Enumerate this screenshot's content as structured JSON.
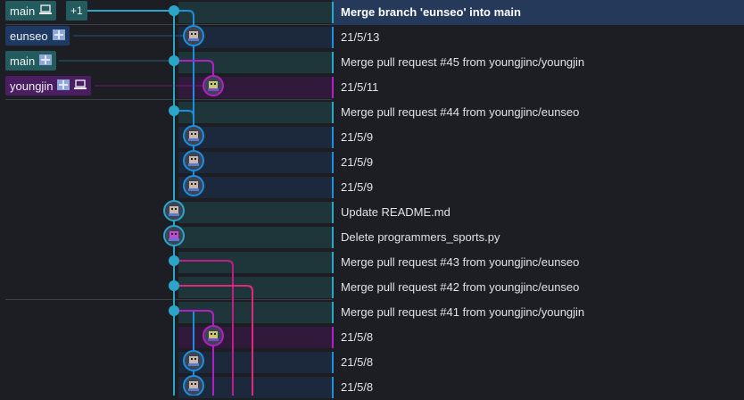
{
  "colors": {
    "background": "#1c1e23",
    "lane_cyan": "#2aa6c9",
    "lane_blue": "#1d8fe0",
    "lane_purple": "#b51ec4",
    "lane_magenta": "#c01e86",
    "lane_pink": "#e0287f",
    "row_teal": "#1f3b3d",
    "row_blue": "#1c2c42",
    "row_purple": "#33183d",
    "selected_row": "#253a5a"
  },
  "branch_labels": [
    {
      "name": "main",
      "icon": "laptop-icon",
      "extra": "+1",
      "row": 0,
      "style": "teal"
    },
    {
      "name": "eunseo",
      "icon": "remote-icon",
      "row": 1,
      "style": "blue"
    },
    {
      "name": "main",
      "icon": "remote-icon",
      "row": 2,
      "style": "teal"
    },
    {
      "name": "youngjin",
      "icon": "remote-icon",
      "icon2": "laptop-icon",
      "row": 3,
      "style": "purple"
    }
  ],
  "commits": [
    {
      "message": "Merge branch 'eunseo' into main",
      "lane": 0,
      "node": "merge",
      "band": "teal",
      "selected": true
    },
    {
      "message": "21/5/13",
      "lane": 1,
      "node": "avatar",
      "band": "blue"
    },
    {
      "message": "Merge pull request #45 from youngjinc/youngjin",
      "lane": 0,
      "node": "merge",
      "band": "teal"
    },
    {
      "message": "21/5/11",
      "lane": 2,
      "node": "avatar",
      "band": "purple"
    },
    {
      "message": "Merge pull request #44 from youngjinc/eunseo",
      "lane": 0,
      "node": "merge",
      "band": "teal"
    },
    {
      "message": "21/5/9",
      "lane": 1,
      "node": "avatar",
      "band": "blue"
    },
    {
      "message": "21/5/9",
      "lane": 1,
      "node": "avatar",
      "band": "blue"
    },
    {
      "message": "21/5/9",
      "lane": 1,
      "node": "avatar",
      "band": "blue"
    },
    {
      "message": "Update README.md",
      "lane": 0,
      "node": "avatar",
      "band": "teal"
    },
    {
      "message": "Delete programmers_sports.py",
      "lane": 0,
      "node": "avatar-purple",
      "band": "teal"
    },
    {
      "message": "Merge pull request #43 from youngjinc/eunseo",
      "lane": 0,
      "node": "merge",
      "band": "teal"
    },
    {
      "message": "Merge pull request #42 from youngjinc/eunseo",
      "lane": 0,
      "node": "merge",
      "band": "teal"
    },
    {
      "message": "Merge pull request #41 from youngjinc/youngjin",
      "lane": 0,
      "node": "merge",
      "band": "teal"
    },
    {
      "message": "21/5/8",
      "lane": 2,
      "node": "avatar",
      "band": "purple"
    },
    {
      "message": "21/5/8",
      "lane": 1,
      "node": "avatar",
      "band": "blue"
    },
    {
      "message": "21/5/8",
      "lane": 1,
      "node": "avatar",
      "band": "blue"
    }
  ]
}
